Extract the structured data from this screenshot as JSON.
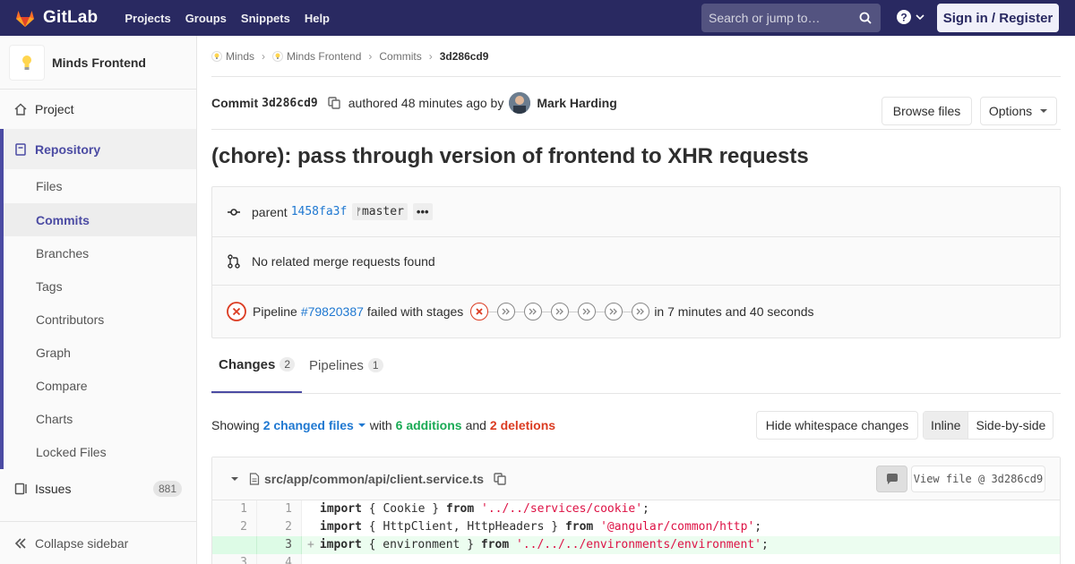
{
  "navbar": {
    "brand": "GitLab",
    "links": [
      "Projects",
      "Groups",
      "Snippets",
      "Help"
    ],
    "search_placeholder": "Search or jump to…",
    "signin": "Sign in / Register"
  },
  "sidebar": {
    "project_name": "Minds Frontend",
    "project": "Project",
    "repository": "Repository",
    "repo_items": [
      "Files",
      "Commits",
      "Branches",
      "Tags",
      "Contributors",
      "Graph",
      "Compare",
      "Charts",
      "Locked Files"
    ],
    "active_item": "Commits",
    "issues": "Issues",
    "issues_count": "881",
    "collapse": "Collapse sidebar"
  },
  "breadcrumb": {
    "items": [
      "Minds",
      "Minds Frontend",
      "Commits"
    ],
    "current": "3d286cd9"
  },
  "commit": {
    "label": "Commit",
    "sha": "3d286cd9",
    "authored": "authored 48 minutes ago by",
    "author": "Mark Harding",
    "browse_files": "Browse files",
    "options": "Options",
    "title": "(chore): pass through version of frontend to XHR requests",
    "parent_label": "parent",
    "parent_sha": "1458fa3f",
    "branch": "master",
    "merge_requests": "No related merge requests found",
    "pipeline_label": "Pipeline",
    "pipeline_id": "#79820387",
    "pipeline_status": "failed with stages",
    "pipeline_duration": "in 7 minutes and 40 seconds"
  },
  "tabs": {
    "changes": "Changes",
    "changes_count": "2",
    "pipelines": "Pipelines",
    "pipelines_count": "1"
  },
  "summary": {
    "showing": "Showing",
    "files": "2 changed files",
    "with": "with",
    "additions": "6 additions",
    "and": "and",
    "deletions": "2 deletions",
    "hide_ws": "Hide whitespace changes",
    "inline": "Inline",
    "side_by_side": "Side-by-side"
  },
  "file": {
    "path": "src/app/common/api/client.service.ts",
    "view_file": "View file @ 3d286cd9"
  },
  "diff": [
    {
      "old": "1",
      "new": "1",
      "type": "context",
      "pre": "import",
      "mid": " { Cookie } ",
      "kw2": "from",
      "str": "'../../services/cookie'",
      "end": ";"
    },
    {
      "old": "2",
      "new": "2",
      "type": "context",
      "pre": "import",
      "mid": " { HttpClient, HttpHeaders } ",
      "kw2": "from",
      "str": "'@angular/common/http'",
      "end": ";"
    },
    {
      "old": "",
      "new": "3",
      "type": "add",
      "pre": "import",
      "mid": " { environment } ",
      "kw2": "from",
      "str": "'../../../environments/environment'",
      "end": ";"
    },
    {
      "old": "3",
      "new": "4",
      "type": "context",
      "pre": "",
      "mid": "",
      "kw2": "",
      "str": "",
      "end": ""
    }
  ]
}
